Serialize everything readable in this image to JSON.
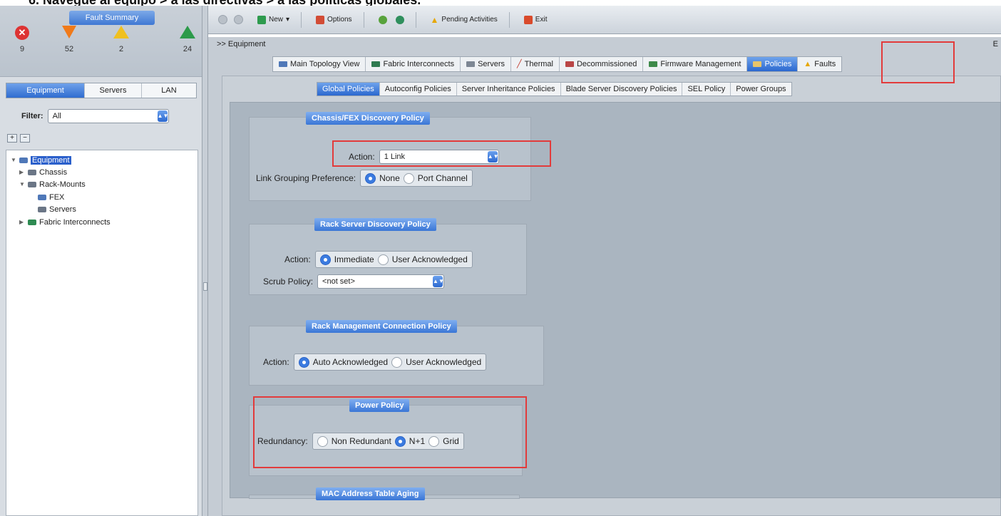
{
  "caption": "6. Navegue al equipo > a las directivas > a las políticas globales.",
  "fault_summary": {
    "title": "Fault Summary",
    "items": [
      {
        "kind": "critical",
        "count": "9"
      },
      {
        "kind": "major",
        "count": "52"
      },
      {
        "kind": "minor",
        "count": "2"
      },
      {
        "kind": "warning",
        "count": "24"
      }
    ]
  },
  "left_tabs": [
    "Equipment",
    "Servers",
    "LAN"
  ],
  "filter": {
    "label": "Filter:",
    "value": "All"
  },
  "tree": [
    {
      "label": "Equipment"
    },
    {
      "label": "Chassis"
    },
    {
      "label": "Rack-Mounts"
    },
    {
      "label": "FEX"
    },
    {
      "label": "Servers"
    },
    {
      "label": "Fabric Interconnects"
    }
  ],
  "toolbar": {
    "new": "New",
    "options": "Options",
    "pending": "Pending Activities",
    "exit": "Exit"
  },
  "breadcrumb": ">> Equipment",
  "breadcrumb_right": "E",
  "top_tabs": [
    "Main Topology View",
    "Fabric Interconnects",
    "Servers",
    "Thermal",
    "Decommissioned",
    "Firmware Management",
    "Policies",
    "Faults"
  ],
  "sub_tabs": [
    "Global Policies",
    "Autoconfig Policies",
    "Server Inheritance Policies",
    "Blade Server Discovery Policies",
    "SEL Policy",
    "Power Groups"
  ],
  "chassis_policy": {
    "title": "Chassis/FEX Discovery Policy",
    "action_label": "Action:",
    "action_value": "1 Link",
    "link_label": "Link Grouping Preference:",
    "opt_none": "None",
    "opt_port": "Port Channel"
  },
  "rack_policy": {
    "title": "Rack Server Discovery Policy",
    "action_label": "Action:",
    "opt_immediate": "Immediate",
    "opt_user": "User Acknowledged",
    "scrub_label": "Scrub Policy:",
    "scrub_value": "<not set>"
  },
  "rack_mgmt": {
    "title": "Rack Management Connection Policy",
    "action_label": "Action:",
    "opt_auto": "Auto Acknowledged",
    "opt_user": "User Acknowledged"
  },
  "power_policy": {
    "title": "Power Policy",
    "label": "Redundancy:",
    "opt_non": "Non Redundant",
    "opt_n1": "N+1",
    "opt_grid": "Grid"
  },
  "mac_aging": {
    "title": "MAC Address Table Aging"
  }
}
